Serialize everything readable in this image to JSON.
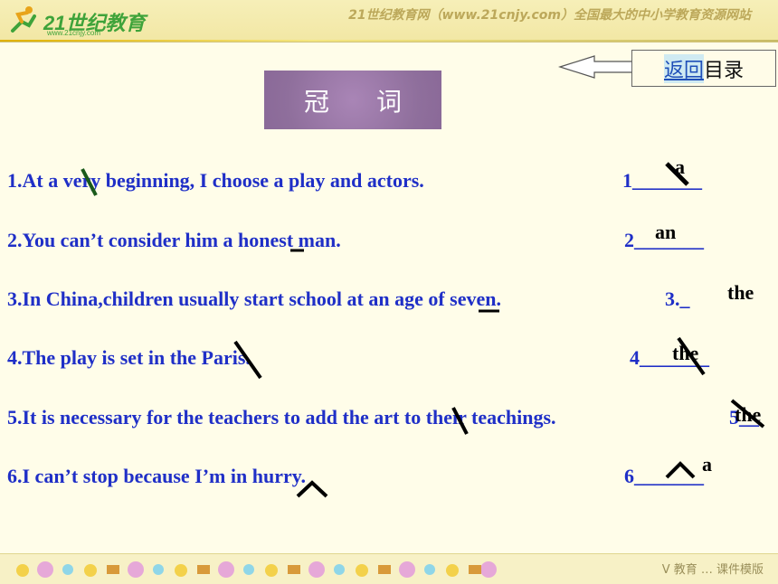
{
  "header": {
    "logo_text": "21世纪教育",
    "logo_sub": "www.21cnjy.com",
    "banner": "21世纪教育网（www.21cnjy.com）全国最大的中小学教育资源网站"
  },
  "nav": {
    "back_link": "返回",
    "back_rest": "目录"
  },
  "title": {
    "char1": "冠",
    "char2": "词"
  },
  "sentences": [
    {
      "text": "1.At a very beginning, I choose a play and actors.",
      "blank": "1_______",
      "answer": "a"
    },
    {
      "text": "2.You can’t consider him a honest man.",
      "blank": "2_______",
      "answer": "an"
    },
    {
      "text": "3.In China,children usually start school at an age of seven.",
      "blank": "3._",
      "answer": "the"
    },
    {
      "text": "4.The play is set in the Paris.",
      "blank": "4_______",
      "answer": "the"
    },
    {
      "text": "5.It is necessary for the teachers to add the art to their teachings.",
      "blank": "5__",
      "answer": "the"
    },
    {
      "text": "6.I can’t stop because I’m in hurry.",
      "blank": "6_______",
      "answer": "a"
    }
  ],
  "footer": {
    "text": "Ⅴ 教育  …  课件模版"
  },
  "colors": {
    "sentence": "#1f2fc7",
    "answer": "#000000",
    "title_bg": "#9b7aa8"
  }
}
